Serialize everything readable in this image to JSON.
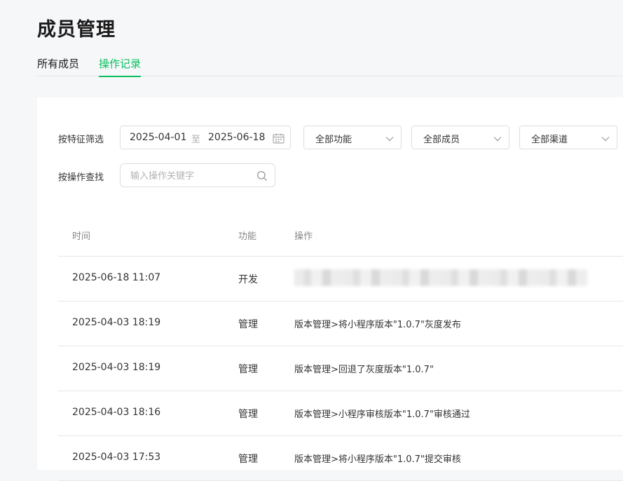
{
  "page": {
    "title": "成员管理"
  },
  "tabs": [
    {
      "label": "所有成员",
      "active": false
    },
    {
      "label": "操作记录",
      "active": true
    }
  ],
  "colors": {
    "accent": "#07c160"
  },
  "filters": {
    "feature_label": "按特征筛选",
    "date_start": "2025-04-01",
    "date_sep": "至",
    "date_end": "2025-06-18",
    "function_select": "全部功能",
    "member_select": "全部成员",
    "channel_select": "全部渠道",
    "search_label": "按操作查找",
    "search_placeholder": "输入操作关键字",
    "search_value": ""
  },
  "icons": {
    "calendar": "calendar-icon",
    "chevron": "chevron-down-icon",
    "search": "search-icon"
  },
  "table": {
    "headers": {
      "time": "时间",
      "function": "功能",
      "operation": "操作"
    },
    "rows": [
      {
        "time": "2025-06-18 11:07",
        "function": "开发",
        "operation": "",
        "redacted": true
      },
      {
        "time": "2025-04-03 18:19",
        "function": "管理",
        "operation": "版本管理>将小程序版本\"1.0.7\"灰度发布"
      },
      {
        "time": "2025-04-03 18:19",
        "function": "管理",
        "operation": "版本管理>回退了灰度版本\"1.0.7\""
      },
      {
        "time": "2025-04-03 18:16",
        "function": "管理",
        "operation": "版本管理>小程序审核版本\"1.0.7\"审核通过"
      },
      {
        "time": "2025-04-03 17:53",
        "function": "管理",
        "operation": "版本管理>将小程序版本\"1.0.7\"提交审核"
      }
    ]
  }
}
